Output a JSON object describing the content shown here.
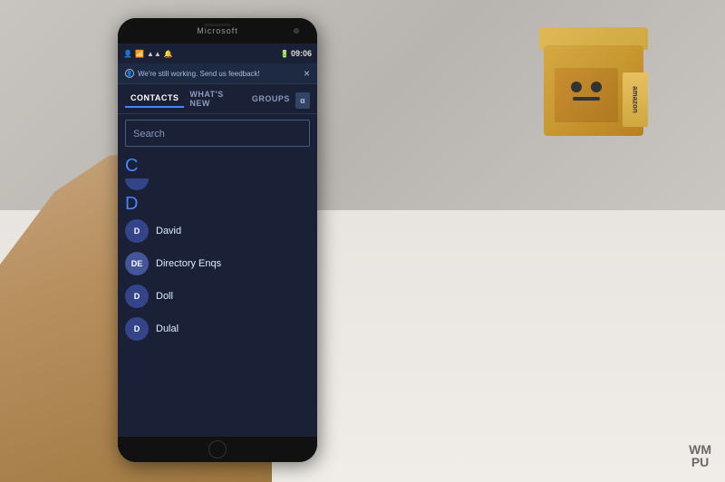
{
  "background": {
    "color": "#d0ccc8"
  },
  "phone": {
    "brand": "Microsoft",
    "status_bar": {
      "time": "09:06",
      "icons": [
        "person-icon",
        "signal-icon",
        "wifi-icon",
        "bell-icon"
      ],
      "battery_level": "full"
    },
    "notification": {
      "text": "We're still working. Send us feedback!",
      "close_label": "×"
    },
    "tabs": [
      {
        "label": "CONTACTS",
        "active": true
      },
      {
        "label": "WHAT'S NEW",
        "active": false
      },
      {
        "label": "GROUPS",
        "active": false
      }
    ],
    "alpha_button": "α",
    "search": {
      "placeholder": "Search"
    },
    "sections": [
      {
        "letter": "C",
        "contacts": []
      },
      {
        "letter": "D",
        "contacts": [
          {
            "initials": "D",
            "name": "David",
            "avatar_color": "#334488"
          },
          {
            "initials": "DE",
            "name": "Directory Enqs",
            "avatar_color": "#445599"
          },
          {
            "initials": "D",
            "name": "Doll",
            "avatar_color": "#334488"
          },
          {
            "initials": "D",
            "name": "Dulal",
            "avatar_color": "#334488"
          }
        ]
      }
    ]
  },
  "watermark": {
    "line1": "WM",
    "line2": "PU"
  },
  "amazon_box": {
    "label": "amazon"
  }
}
